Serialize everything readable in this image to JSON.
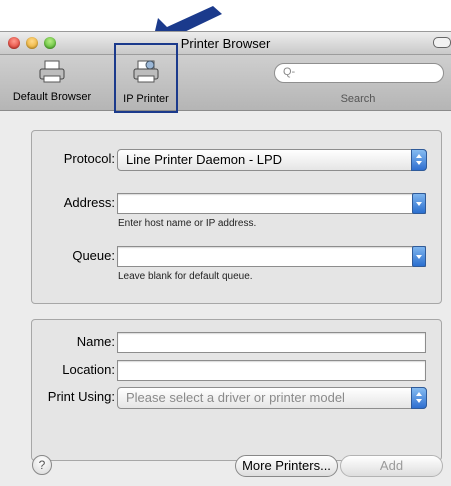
{
  "window": {
    "title": "Printer Browser"
  },
  "toolbar": {
    "default_label": "Default Browser",
    "ip_label": "IP Printer",
    "search_placeholder": "Q-",
    "search_label": "Search"
  },
  "form": {
    "protocol_label": "Protocol:",
    "protocol_value": "Line Printer Daemon - LPD",
    "address_label": "Address:",
    "address_value": "",
    "address_hint": "Enter host name or IP address.",
    "queue_label": "Queue:",
    "queue_value": "",
    "queue_hint": "Leave blank for default queue.",
    "name_label": "Name:",
    "name_value": "",
    "location_label": "Location:",
    "location_value": "",
    "print_using_label": "Print Using:",
    "print_using_value": "Please select a driver or printer model"
  },
  "footer": {
    "help_glyph": "?",
    "more_printers": "More Printers...",
    "add": "Add"
  },
  "colors": {
    "highlight_box": "#1b3a8c",
    "arrow": "#1b3a8c"
  }
}
